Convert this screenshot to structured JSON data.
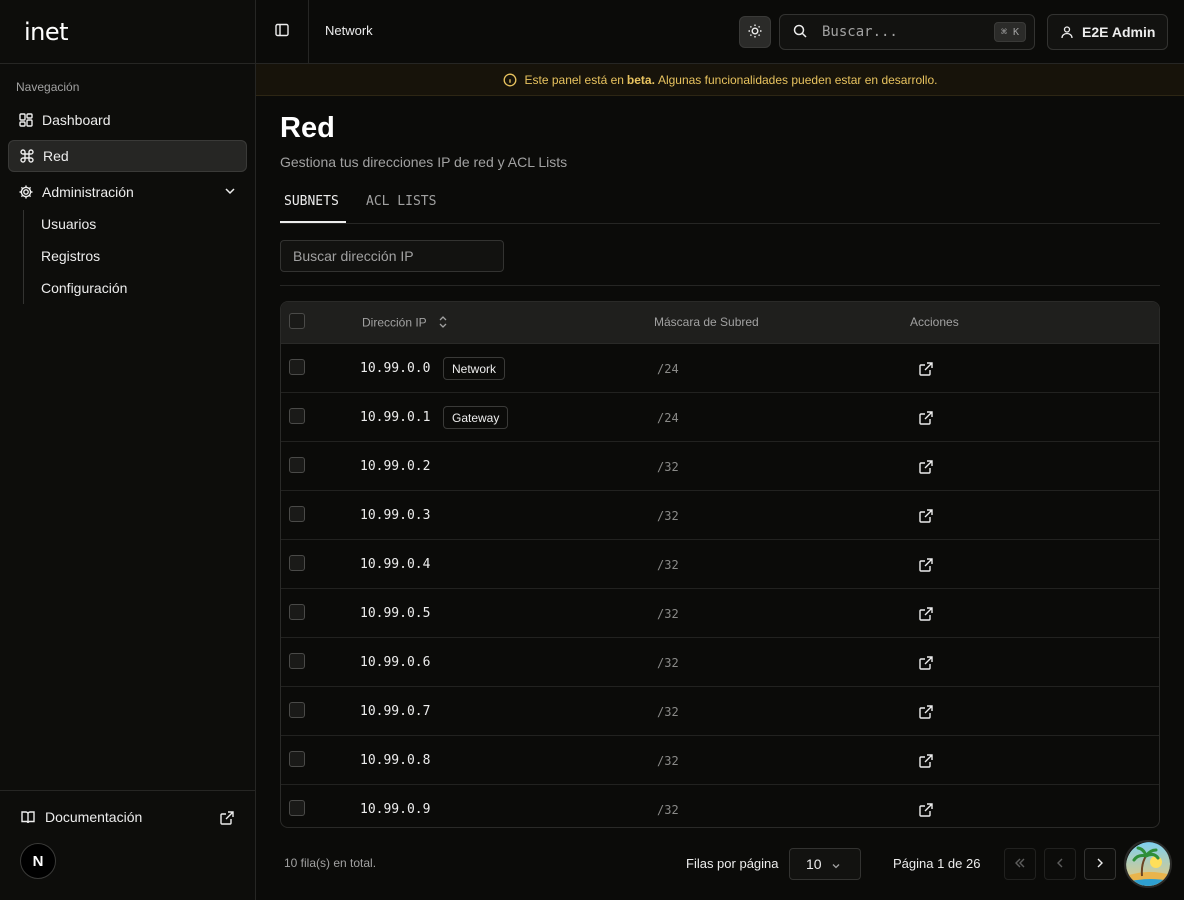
{
  "brand": {
    "logo_text": "inet"
  },
  "sidebar": {
    "section_label": "Navegación",
    "items": [
      {
        "label": "Dashboard",
        "icon": "dashboard-icon"
      },
      {
        "label": "Red",
        "icon": "command-icon",
        "active": true
      },
      {
        "label": "Administración",
        "icon": "gear-icon",
        "expanded": true
      }
    ],
    "subitems": [
      {
        "label": "Usuarios"
      },
      {
        "label": "Registros"
      },
      {
        "label": "Configuración"
      }
    ],
    "footer": {
      "doc_label": "Documentación",
      "avatar_letter": "N"
    }
  },
  "topbar": {
    "breadcrumb": "Network",
    "search_placeholder": "Buscar...",
    "shortcut": "⌘ K",
    "user_label": "E2E Admin"
  },
  "beta_banner": {
    "prefix": "Este panel está en",
    "bold": "beta.",
    "suffix": "Algunas funcionalidades pueden estar en desarrollo."
  },
  "page": {
    "title": "Red",
    "subtitle": "Gestiona tus direcciones IP de red y ACL Lists",
    "tabs": [
      "SUBNETS",
      "ACL LISTS"
    ],
    "search_placeholder": "Buscar dirección IP"
  },
  "table": {
    "headers": {
      "ip": "Dirección IP",
      "mask": "Máscara de Subred",
      "actions": "Acciones"
    },
    "rows": [
      {
        "ip": "10.99.0.0",
        "badge": "Network",
        "mask": "/24"
      },
      {
        "ip": "10.99.0.1",
        "badge": "Gateway",
        "mask": "/24"
      },
      {
        "ip": "10.99.0.2",
        "badge": "",
        "mask": "/32"
      },
      {
        "ip": "10.99.0.3",
        "badge": "",
        "mask": "/32"
      },
      {
        "ip": "10.99.0.4",
        "badge": "",
        "mask": "/32"
      },
      {
        "ip": "10.99.0.5",
        "badge": "",
        "mask": "/32"
      },
      {
        "ip": "10.99.0.6",
        "badge": "",
        "mask": "/32"
      },
      {
        "ip": "10.99.0.7",
        "badge": "",
        "mask": "/32"
      },
      {
        "ip": "10.99.0.8",
        "badge": "",
        "mask": "/32"
      },
      {
        "ip": "10.99.0.9",
        "badge": "",
        "mask": "/32"
      }
    ]
  },
  "pagination": {
    "total_text": "10 fila(s) en total.",
    "rows_per_page_label": "Filas por página",
    "rows_per_page_value": "10",
    "page_text": "Página 1 de 26"
  },
  "colors": {
    "background": "#0b0b09",
    "banner_text": "#e8c35f",
    "banner_bg": "#17130a"
  }
}
